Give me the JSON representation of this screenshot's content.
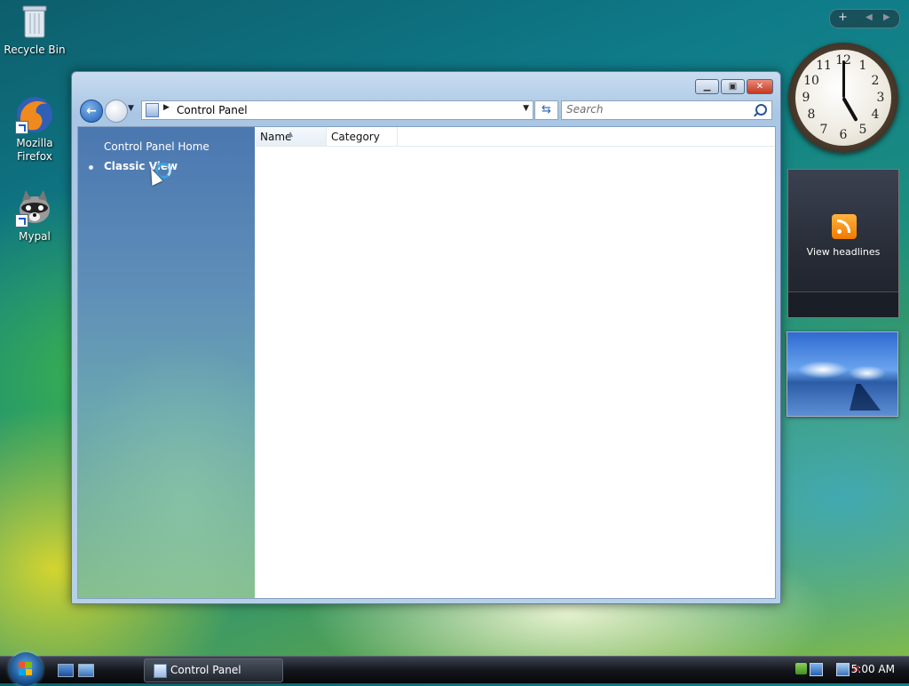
{
  "desktop": {
    "icons": [
      {
        "label": "Recycle Bin",
        "icon": "recycle-bin-icon"
      },
      {
        "label": "Mozilla Firefox",
        "icon": "firefox-icon"
      },
      {
        "label": "Mypal",
        "icon": "mypal-raccoon-icon"
      }
    ]
  },
  "window": {
    "address": "Control Panel",
    "search_placeholder": "Search",
    "task_pane": {
      "home_link": "Control Panel Home",
      "classic_link": "Classic View"
    },
    "columns": [
      "Name",
      "Category"
    ]
  },
  "sidebar_gadgets": {
    "clock": {
      "hours": 5,
      "minutes": 0
    },
    "headlines_label": "View headlines"
  },
  "taskbar": {
    "task_button": "Control Panel",
    "time": "5:00 AM"
  },
  "colors": {
    "accent": "#1d5fb4",
    "task_pane_top": "#4b77b0",
    "task_pane_bottom": "#86c08e"
  }
}
